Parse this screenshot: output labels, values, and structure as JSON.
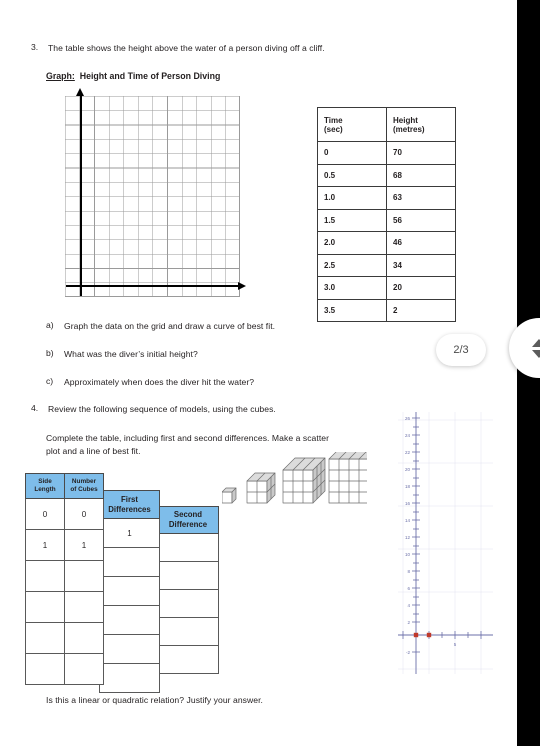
{
  "document": {
    "page_indicator": "2/3"
  },
  "q3": {
    "number": "3.",
    "prompt": "The table shows the height above the water of a person diving off a cliff.",
    "graph_label": "Graph:",
    "graph_title": "Height and Time of Person Diving",
    "table": {
      "headers": [
        {
          "main": "Time",
          "sub": "(sec)"
        },
        {
          "main": "Height",
          "sub": "(metres)"
        }
      ],
      "rows": [
        {
          "time": "0",
          "height": "70"
        },
        {
          "time": "0.5",
          "height": "68"
        },
        {
          "time": "1.0",
          "height": "63"
        },
        {
          "time": "1.5",
          "height": "56"
        },
        {
          "time": "2.0",
          "height": "46"
        },
        {
          "time": "2.5",
          "height": "34"
        },
        {
          "time": "3.0",
          "height": "20"
        },
        {
          "time": "3.5",
          "height": "2"
        }
      ]
    },
    "parts": [
      {
        "label": "a)",
        "text": "Graph the data on the grid and draw a curve of best fit."
      },
      {
        "label": "b)",
        "text": "What was the diver’s initial height?"
      },
      {
        "label": "c)",
        "text": "Approximately when does the diver hit the water?"
      }
    ]
  },
  "q4": {
    "number": "4.",
    "prompt": "Review the following sequence of models, using the cubes.",
    "instruction_line1": "Complete the table, including first and second differences. Make a scatter",
    "instruction_line2": "plot and a line of best fit.",
    "closing_question": "Is this a linear or quadratic relation?  Justify your answer.",
    "side_table": {
      "header_col1_line1": "Side",
      "header_col1_line2": "Length",
      "header_col2_line1": "Number",
      "header_col2_line2": "of Cubes",
      "rows": [
        {
          "side": "0",
          "cubes": "0"
        },
        {
          "side": "1",
          "cubes": "1"
        },
        {
          "side": "",
          "cubes": ""
        },
        {
          "side": "",
          "cubes": ""
        },
        {
          "side": "",
          "cubes": ""
        },
        {
          "side": "",
          "cubes": ""
        }
      ]
    },
    "first_diff_table": {
      "header_line1": "First",
      "header_line2": "Differences",
      "rows": [
        "1",
        "",
        "",
        "",
        "",
        ""
      ]
    },
    "second_diff_table": {
      "header_line1": "Second",
      "header_line2": "Difference",
      "rows": [
        "",
        "",
        "",
        "",
        ""
      ]
    },
    "cube_models": [
      {
        "side": 1
      },
      {
        "side": 2
      },
      {
        "side": 3
      },
      {
        "side": 4
      }
    ]
  },
  "chart_data": {
    "type": "scatter",
    "title": "",
    "xlabel": "",
    "ylabel": "",
    "xlim": [
      -1,
      9
    ],
    "ylim": [
      -3,
      27
    ],
    "grid": true,
    "x_tick_labels": [
      {
        "value": 5,
        "label": "5"
      }
    ],
    "y_tick_labels": [
      {
        "value": 2,
        "label": "2"
      },
      {
        "value": 4,
        "label": "4"
      },
      {
        "value": 6,
        "label": "6"
      },
      {
        "value": 8,
        "label": "8"
      },
      {
        "value": 10,
        "label": "10"
      },
      {
        "value": 12,
        "label": "12"
      },
      {
        "value": 14,
        "label": "14"
      },
      {
        "value": 16,
        "label": "16"
      },
      {
        "value": 18,
        "label": "18"
      },
      {
        "value": 20,
        "label": "20"
      },
      {
        "value": 22,
        "label": "22"
      },
      {
        "value": 24,
        "label": "24"
      },
      {
        "value": 26,
        "label": "26"
      },
      {
        "value": -2,
        "label": "-2"
      }
    ],
    "points": [
      {
        "x": 0,
        "y": 0
      },
      {
        "x": 1,
        "y": 0
      }
    ],
    "point_color": "#c0392b",
    "axis_color": "#6b6fa8",
    "grid_color": "#dcdcee"
  },
  "grid_graph": {
    "columns": 12,
    "rows": 14,
    "x_axis_arrow": "arrow-right",
    "y_axis_arrow": "arrow-up"
  }
}
